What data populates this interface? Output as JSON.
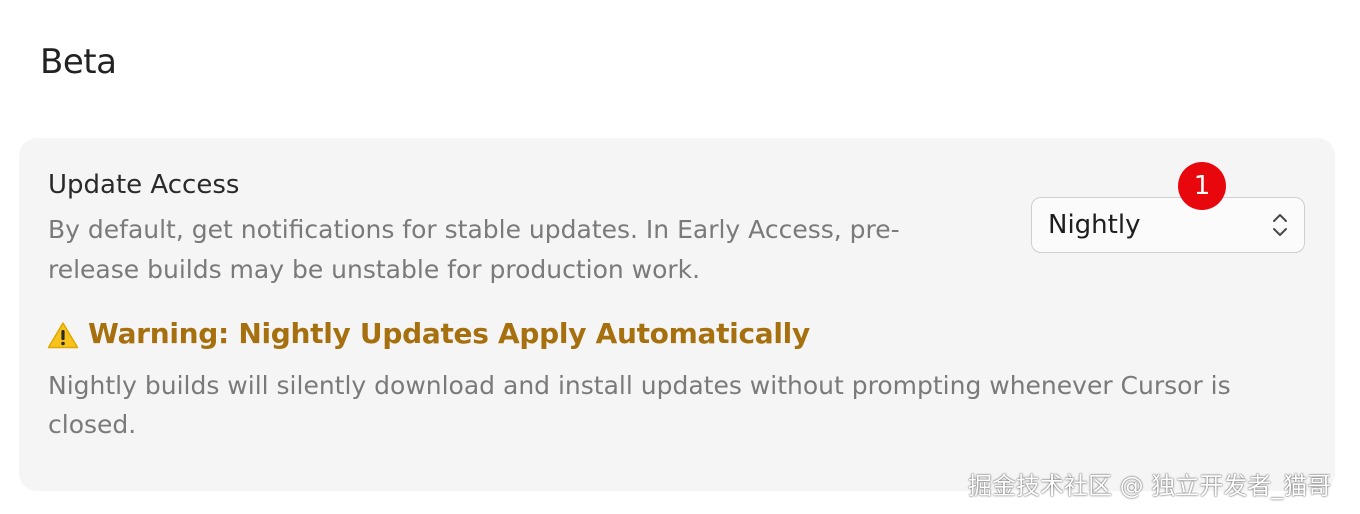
{
  "section": {
    "title": "Beta"
  },
  "setting": {
    "title": "Update Access",
    "description": "By default, get notifications for stable updates. In Early Access, pre-release builds may be unstable for production work.",
    "select": {
      "value": "Nightly",
      "icon": "chevron-updown-icon"
    },
    "badge": {
      "count": "1",
      "color": "#e8070d"
    }
  },
  "warning": {
    "icon": "warning-icon",
    "title": "Warning: Nightly Updates Apply Automatically",
    "title_color": "#a6700f",
    "description": "Nightly builds will silently download and install updates without prompting whenever Cursor is closed."
  },
  "watermark": {
    "text": "掘金技术社区 @ 独立开发者_猫哥"
  }
}
